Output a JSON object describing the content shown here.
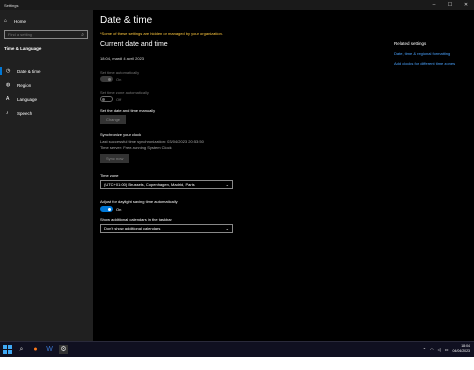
{
  "window": {
    "title": "Settings",
    "controls": [
      "–",
      "☐",
      "✕"
    ]
  },
  "sidebar": {
    "home_label": "Home",
    "search_placeholder": "Find a setting",
    "section_heading": "Time & Language",
    "items": [
      {
        "label": "Date & time",
        "icon": "clock-icon",
        "active": true
      },
      {
        "label": "Region",
        "icon": "globe-icon",
        "active": false
      },
      {
        "label": "Language",
        "icon": "language-icon",
        "active": false
      },
      {
        "label": "Speech",
        "icon": "microphone-icon",
        "active": false
      }
    ]
  },
  "main": {
    "title": "Date & time",
    "warning": "*Some of these settings are hidden or managed by your organization.",
    "current_heading": "Current date and time",
    "current_value": "18:04, mardi 4 avril 2023",
    "set_time_auto_label": "Set time automatically",
    "set_time_auto_state": "On",
    "set_tz_auto_label": "Set time zone automatically",
    "set_tz_auto_state": "Off",
    "set_manual_label": "Set the date and time manually",
    "change_button": "Change",
    "sync_heading": "Synchronize your clock",
    "sync_last": "Last successful time synchronization: 03/04/2023 20:53:50",
    "sync_server": "Time server: Free-running System Clock",
    "sync_button": "Sync now",
    "timezone_label": "Time zone",
    "timezone_value": "(UTC+01:00) Brussels, Copenhagen, Madrid, Paris",
    "dst_label": "Adjust for daylight saving time automatically",
    "dst_state": "On",
    "calendar_label": "Show additional calendars in the taskbar",
    "calendar_value": "Don't show additional calendars"
  },
  "related": {
    "heading": "Related settings",
    "links": [
      "Date, time & regional formatting",
      "Add clocks for different time zones"
    ]
  },
  "taskbar": {
    "clock_time": "18:04",
    "clock_date": "04/04/2023",
    "accent": "#0078d7"
  }
}
